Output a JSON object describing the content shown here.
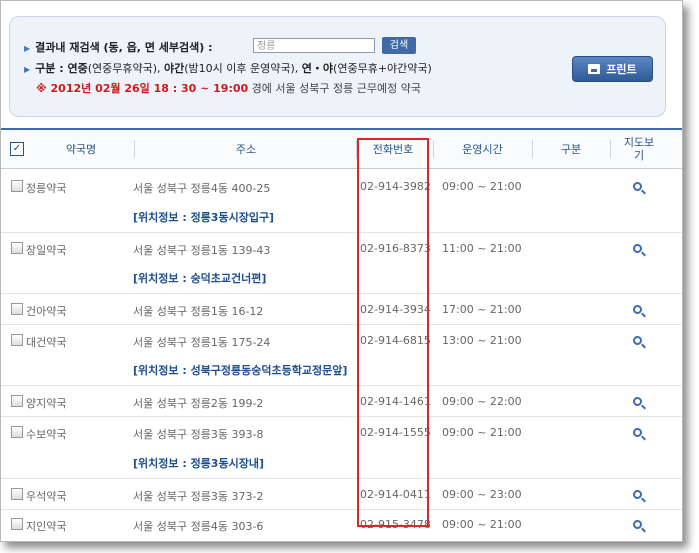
{
  "search": {
    "label": "결과내 재검색 (동, 읍, 면 세부검색) :",
    "value": "정릉",
    "button": "검색",
    "legend_prefix": "구분 : ",
    "legend_1_b": "연중",
    "legend_1_t": "(연중무휴약국), ",
    "legend_2_b": "야간",
    "legend_2_t": "(밤10시 이후 운영약국), ",
    "legend_3_b": "연・야",
    "legend_3_t": "(연중무휴+야간약국)",
    "date_mark": "※ 2012년 02월 26일 18 : 30 ~ 19:00",
    "date_rest": " 경에  서울  성북구  정릉 근무예정 약국",
    "print": "프린트"
  },
  "table": {
    "headers": [
      "약국명",
      "주소",
      "전화번호",
      "운영시간",
      "구분",
      "지도보기"
    ],
    "rows": [
      {
        "name": "정릉약국",
        "addr": "서울 성북구 정릉4동 400-25",
        "phone": "02-914-3982",
        "hours": "09:00 ~ 21:00",
        "loc": "[위치정보 : 정릉3동시장입구]"
      },
      {
        "name": "장일약국",
        "addr": "서울 성북구 정릉1동 139-43",
        "phone": "02-916-8373",
        "hours": "11:00 ~ 21:00",
        "loc": "[위치정보 : 숭덕초교건너편]"
      },
      {
        "name": "건아약국",
        "addr": "서울 성북구 정릉1동 16-12",
        "phone": "02-914-3934",
        "hours": "17:00 ~ 21:00",
        "loc": ""
      },
      {
        "name": "대건약국",
        "addr": "서울 성북구 정릉1동 175-24",
        "phone": "02-914-6815",
        "hours": "13:00 ~ 21:00",
        "loc": "[위치정보 : 성북구정릉동숭덕초등학교정문앞]"
      },
      {
        "name": "양지약국",
        "addr": "서울 성북구 정릉2동 199-2",
        "phone": "02-914-1461",
        "hours": "09:00 ~ 22:00",
        "loc": ""
      },
      {
        "name": "수보약국",
        "addr": "서울 성북구 정릉3동 393-8",
        "phone": "02-914-1555",
        "hours": "09:00 ~ 21:00",
        "loc": "[위치정보 : 정릉3동시장내]"
      },
      {
        "name": "우석약국",
        "addr": "서울 성북구 정릉3동 373-2",
        "phone": "02-914-0411",
        "hours": "09:00 ~ 23:00",
        "loc": ""
      },
      {
        "name": "지인약국",
        "addr": "서울 성북구 정릉4동 303-6",
        "phone": "02-915-3478",
        "hours": "09:00 ~ 21:00",
        "loc": ""
      }
    ]
  },
  "colors": {
    "accent": "#3f6aa6",
    "highlight_box": "#d42a2a",
    "date_red": "#cc1a1a",
    "location_blue": "#1d4f8f"
  }
}
